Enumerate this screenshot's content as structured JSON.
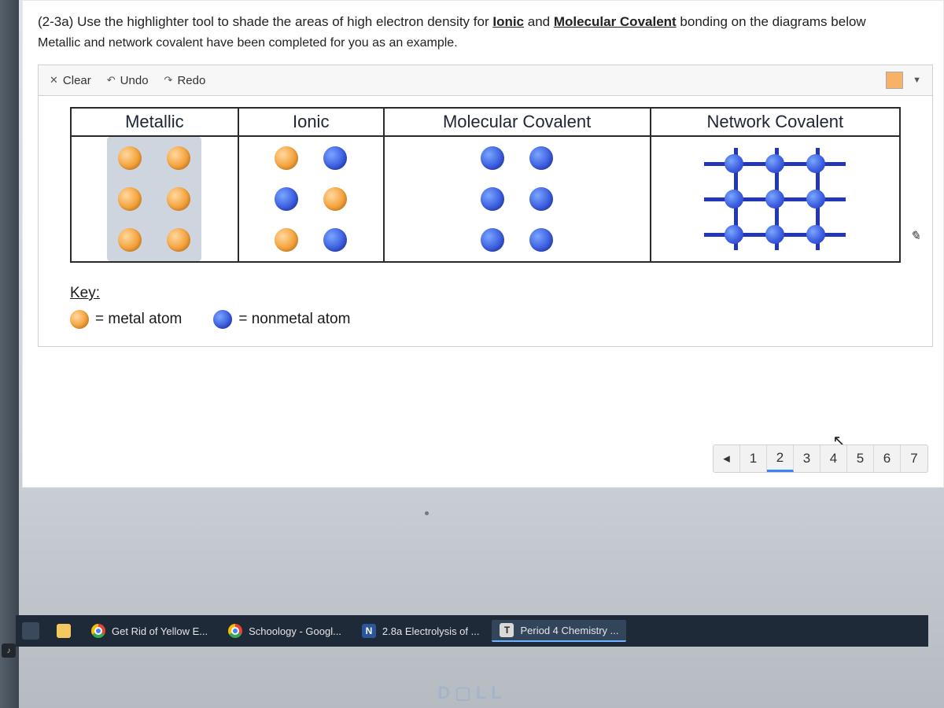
{
  "instruction": {
    "prefix": "(2-3a) Use the highlighter tool to shade the areas of high electron density for ",
    "ionic": "Ionic",
    "and": " and ",
    "molecular": "Molecular Covalent",
    "suffix": " bonding on the diagrams below",
    "line2": "Metallic and network covalent have been completed for you as an example."
  },
  "toolbar": {
    "clear": "Clear",
    "undo": "Undo",
    "redo": "Redo"
  },
  "table": {
    "headers": [
      "Metallic",
      "Ionic",
      "Molecular Covalent",
      "Network Covalent"
    ]
  },
  "key": {
    "title": "Key:",
    "metal": "= metal atom",
    "nonmetal": "= nonmetal atom"
  },
  "pagenav": {
    "prev": "◂",
    "pages": [
      "1",
      "2",
      "3",
      "4",
      "5",
      "6",
      "7"
    ],
    "active_index": 1
  },
  "edit_mark": "✎",
  "taskbar": {
    "items": [
      {
        "icon": "chrome",
        "label": "Get Rid of Yellow E..."
      },
      {
        "icon": "chrome",
        "label": "Schoology - Googl..."
      },
      {
        "icon": "n",
        "label": "2.8a Electrolysis of ..."
      },
      {
        "icon": "t",
        "label": "Period 4 Chemistry ..."
      }
    ],
    "active": 3
  },
  "brand": "D▢LL",
  "knob": "♪"
}
